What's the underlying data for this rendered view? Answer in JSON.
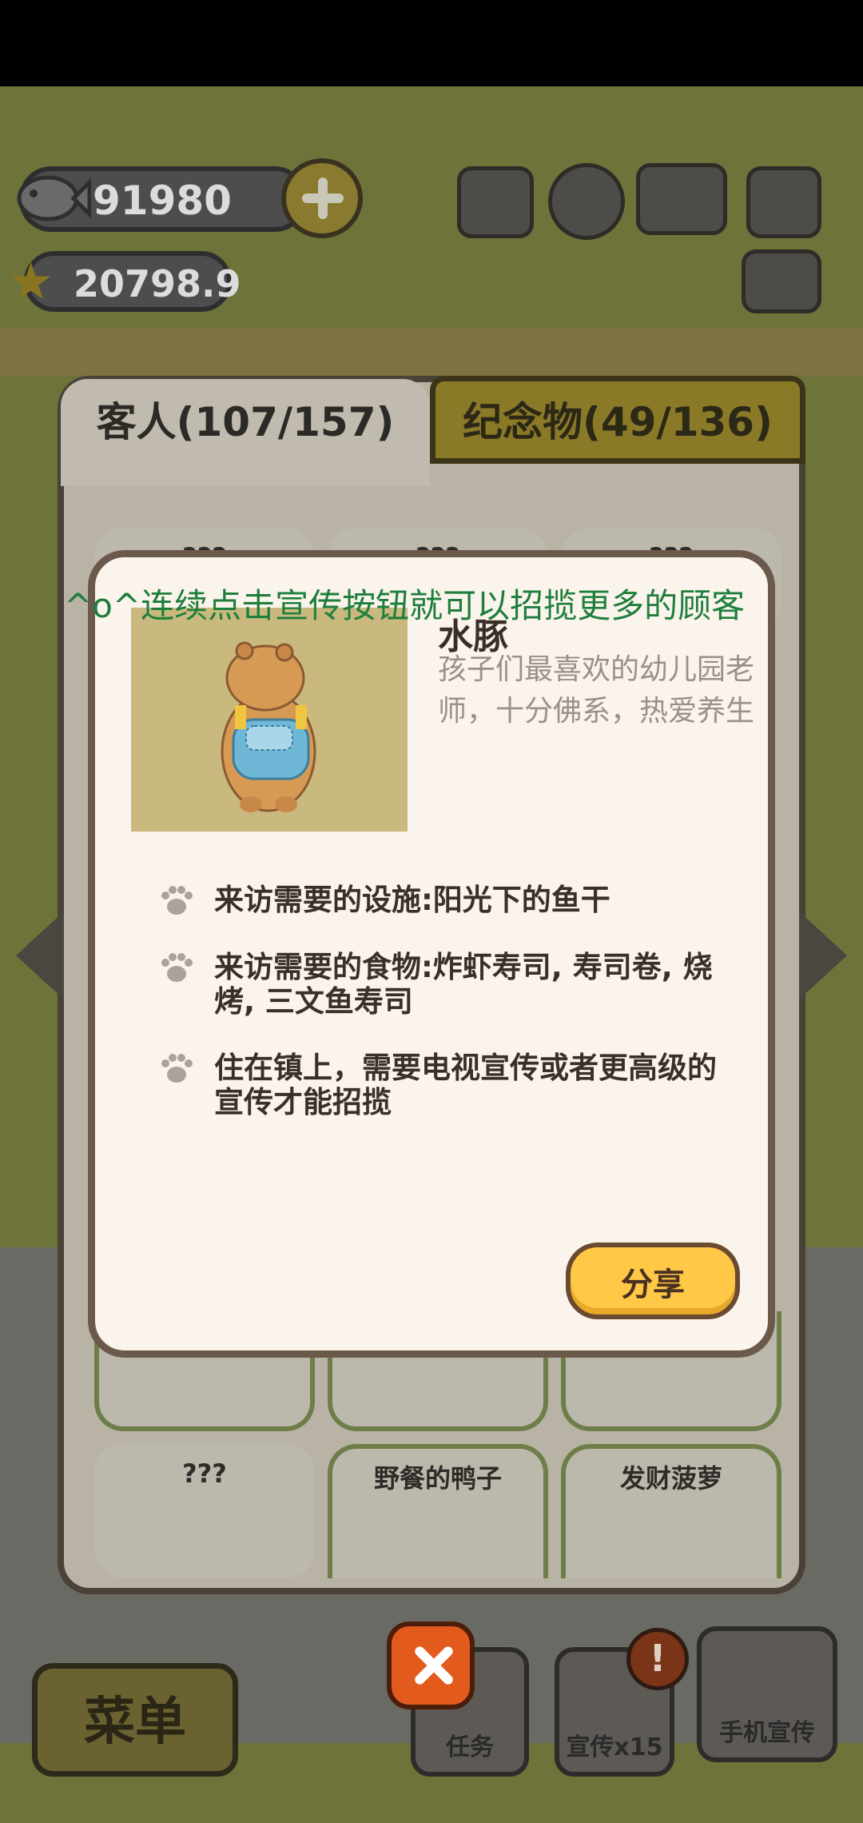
{
  "currency": {
    "fish_amount": "91980",
    "star_amount": "20798.9"
  },
  "tabs": [
    {
      "label": "客人(107/157)"
    },
    {
      "label": "纪念物(49/136)"
    }
  ],
  "cards": [
    {
      "title": "???"
    },
    {
      "title": "???"
    },
    {
      "title": "???"
    },
    {
      "title": "???"
    },
    {
      "title": "野餐的鸭子"
    },
    {
      "title": "发财菠萝"
    }
  ],
  "banner": "^o^连续点击宣传按钮就可以招揽更多的顾客",
  "guest": {
    "name": "水豚",
    "description": "孩子们最喜欢的幼儿园老师，十分佛系，热爱养生",
    "requirements": [
      {
        "text": "来访需要的设施:阳光下的鱼干"
      },
      {
        "text": "来访需要的食物:炸虾寿司, 寿司卷, 烧烤, 三文鱼寿司"
      },
      {
        "text": "住在镇上，需要电视宣传或者更高级的宣传才能招揽"
      }
    ]
  },
  "share_label": "分享",
  "bottom_bar": {
    "menu_label": "菜单",
    "task_label": "任务",
    "promo_label": "宣传x15",
    "phone_label": "手机宣传",
    "alert_symbol": "!"
  },
  "colors": {
    "share_button": "#ffc846",
    "close_button": "#e25a1c",
    "banner_text": "#1e7f3c",
    "dialog_bg": "#fbf4ec"
  },
  "icons": [
    "fish-icon",
    "star-icon",
    "plus-icon",
    "ranking-icon",
    "gear-icon",
    "guidebook-icon",
    "camera-icon",
    "newspaper-icon",
    "paw-icon",
    "close-icon",
    "phone-promo-icon"
  ]
}
